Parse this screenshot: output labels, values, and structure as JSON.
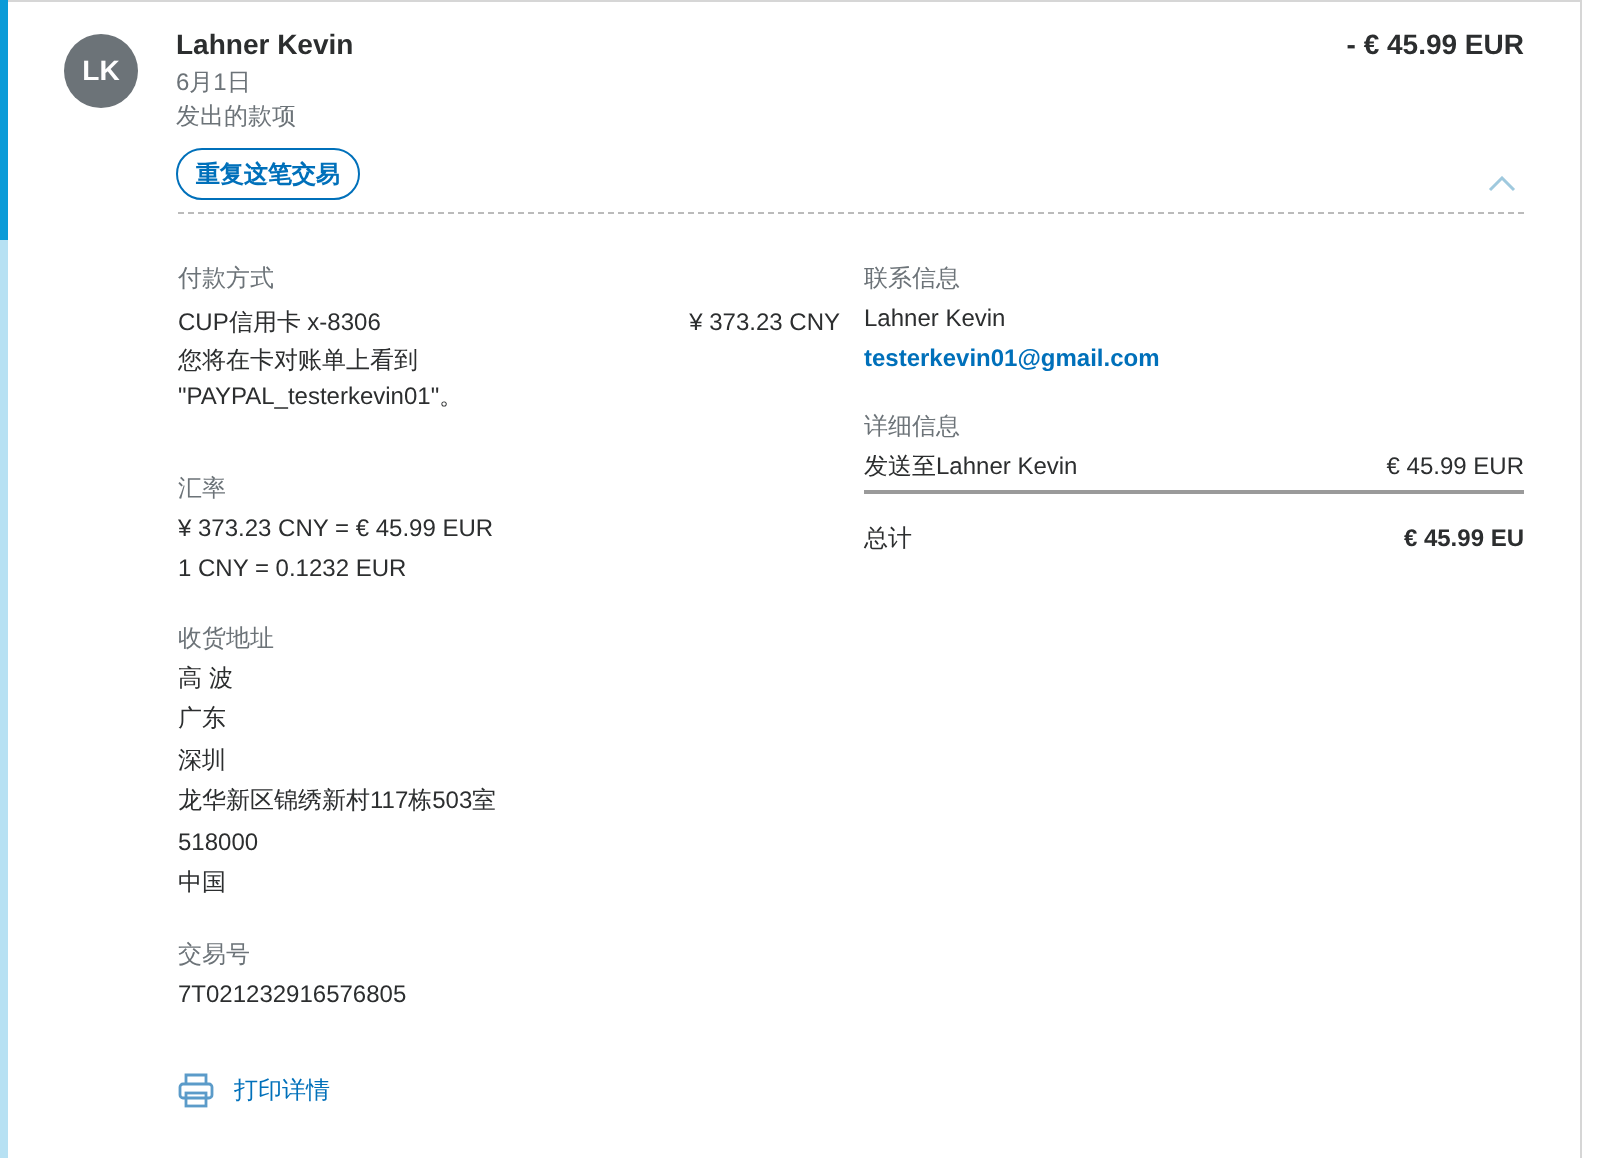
{
  "transaction": {
    "avatar_initials": "LK",
    "name": "Lahner Kevin",
    "date": "6月1日",
    "type": "发出的款项",
    "amount": "- € 45.99 EUR",
    "repeat_button": "重复这笔交易",
    "expanded": true
  },
  "payment": {
    "heading": "付款方式",
    "method": "CUP信用卡 x-8306",
    "amount": "¥ 373.23 CNY",
    "note_lines": [
      "您将在卡对账单上看到",
      "\"PAYPAL_testerkevin01\"。"
    ]
  },
  "exchange": {
    "heading": "汇率",
    "lines": [
      "¥ 373.23 CNY = € 45.99 EUR",
      "1 CNY = 0.1232 EUR"
    ]
  },
  "shipping": {
    "heading": "收货地址",
    "lines": [
      "高 波",
      "广东",
      "深圳",
      "龙华新区锦绣新村117栋503室",
      "518000",
      "中国"
    ]
  },
  "transaction_id": {
    "heading": "交易号",
    "value": "7T021232916576805"
  },
  "print_link": "打印详情",
  "contact": {
    "heading": "联系信息",
    "name": "Lahner Kevin",
    "email": "testerkevin01@gmail.com"
  },
  "details": {
    "heading": "详细信息",
    "rows": [
      {
        "label": "发送至Lahner Kevin",
        "amount": "€ 45.99 EUR",
        "bold": false
      },
      {
        "label": "总计",
        "amount": "€ 45.99 EU",
        "bold": true
      }
    ]
  }
}
